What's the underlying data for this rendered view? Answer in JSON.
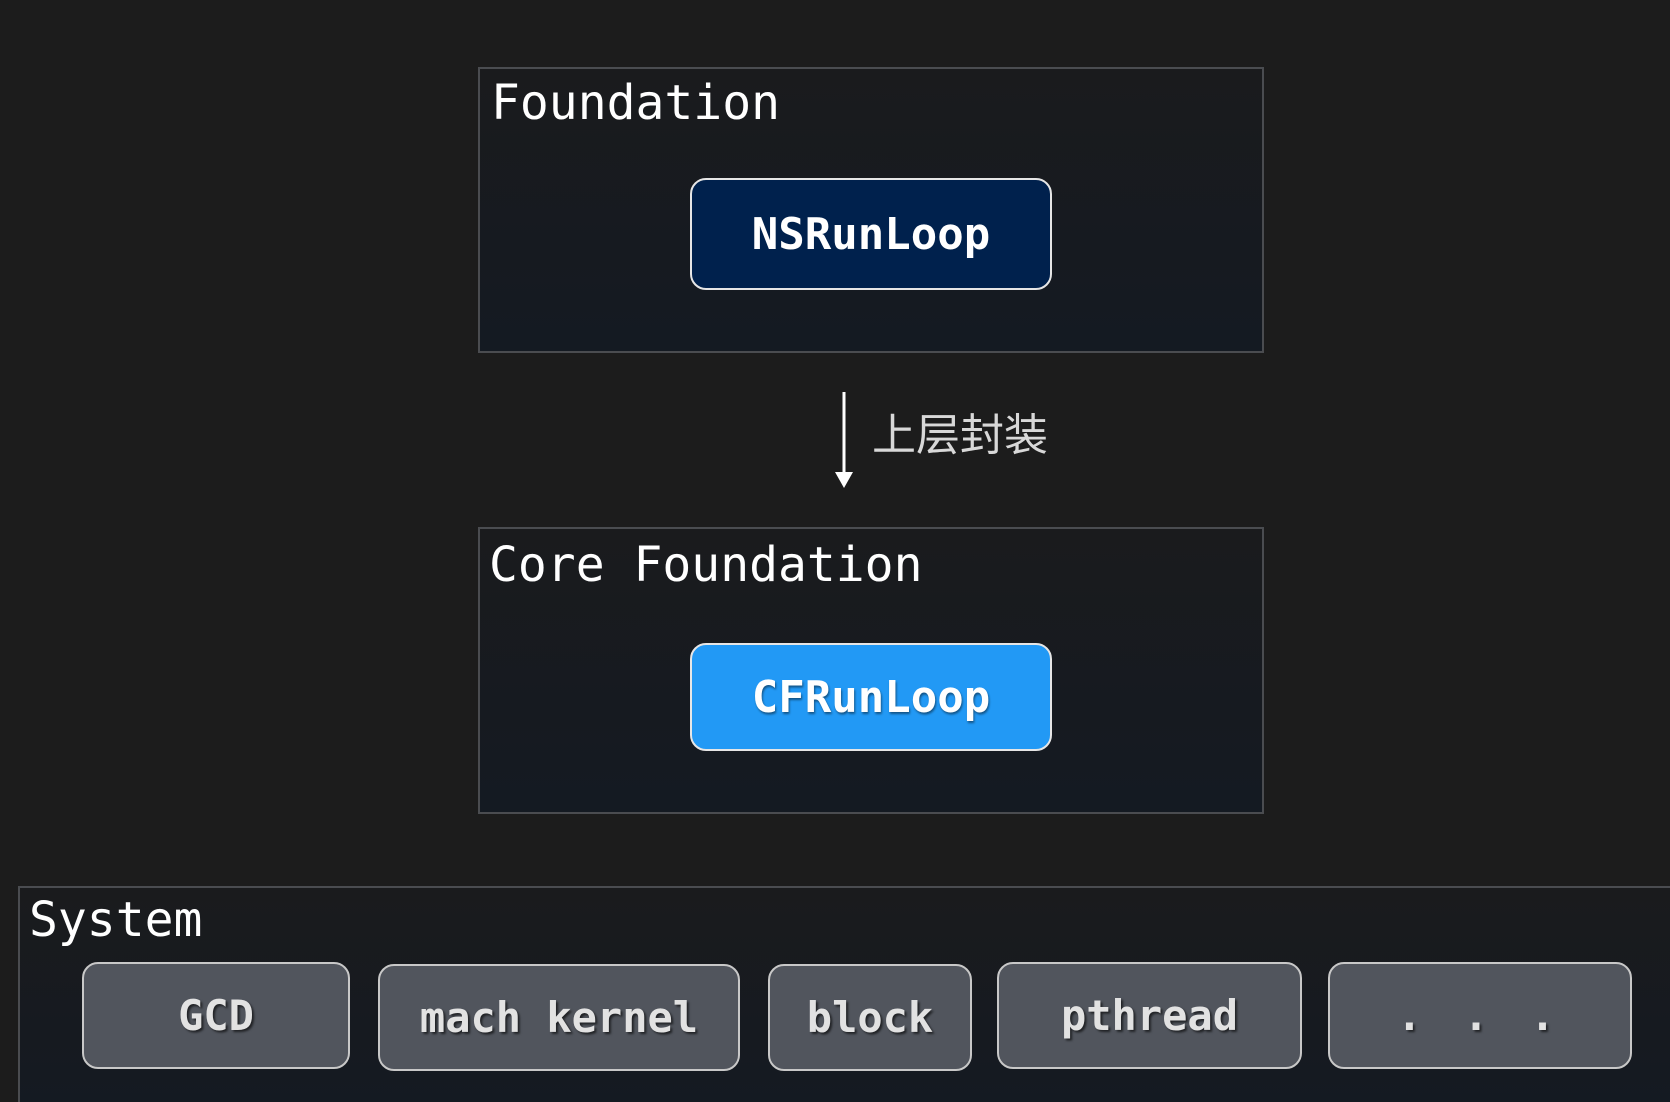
{
  "layers": {
    "foundation": {
      "title": "Foundation",
      "component": "NSRunLoop"
    },
    "core_foundation": {
      "title": "Core Foundation",
      "component": "CFRunLoop"
    },
    "system": {
      "title": "System",
      "components": [
        "GCD",
        "mach kernel",
        "block",
        "pthread",
        ". . ."
      ]
    }
  },
  "relation": {
    "label": "上层封装"
  },
  "colors": {
    "background": "#1c1c1c",
    "ns_runloop": "#00214d",
    "cf_runloop": "#2299f5",
    "system_component": "#51555d"
  }
}
